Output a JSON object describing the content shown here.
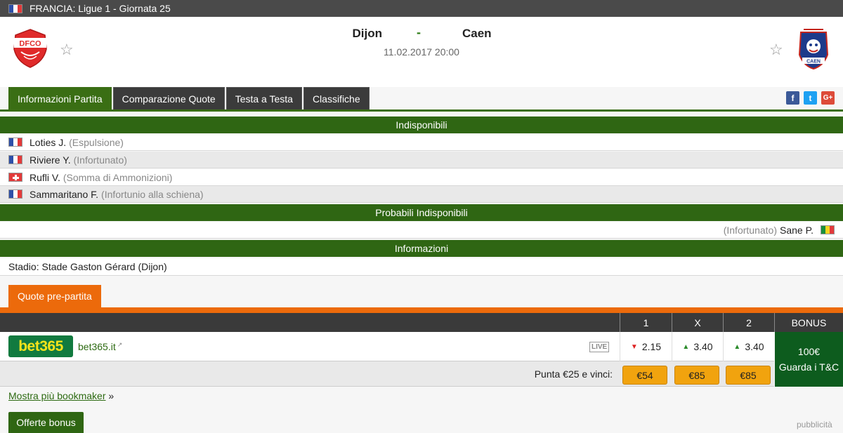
{
  "breadcrumb": {
    "country_league": "FRANCIA: Ligue 1 - Giornata 25"
  },
  "match": {
    "home_team": "Dijon",
    "away_team": "Caen",
    "separator": "-",
    "datetime": "11.02.2017 20:00",
    "home_logo_text": "DFCO",
    "away_logo_text": "CAEN"
  },
  "tabs": [
    {
      "label": "Informazioni Partita",
      "active": true
    },
    {
      "label": "Comparazione Quote",
      "active": false
    },
    {
      "label": "Testa a Testa",
      "active": false
    },
    {
      "label": "Classifiche",
      "active": false
    }
  ],
  "social": {
    "facebook": "f",
    "twitter": "t",
    "google": "G+"
  },
  "unavailable": {
    "title": "Indisponibili",
    "players": [
      {
        "name": "Loties J.",
        "reason": "(Espulsione)",
        "flag": "fr"
      },
      {
        "name": "Riviere Y.",
        "reason": "(Infortunato)",
        "flag": "fr"
      },
      {
        "name": "Rufli V.",
        "reason": "(Somma di Ammonizioni)",
        "flag": "ch"
      },
      {
        "name": "Sammaritano F.",
        "reason": "(Infortunio alla schiena)",
        "flag": "fr"
      }
    ]
  },
  "probable_unavailable": {
    "title": "Probabili Indisponibili",
    "players": [
      {
        "name": "Sane P.",
        "reason": "(Infortunato)",
        "flag": "sn"
      }
    ]
  },
  "info": {
    "title": "Informazioni",
    "stadium": "Stadio: Stade Gaston Gérard (Dijon)"
  },
  "odds": {
    "tab_label": "Quote pre-partita",
    "columns": {
      "home": "1",
      "draw": "X",
      "away": "2",
      "bonus": "BONUS"
    },
    "bookmaker": {
      "logo_text": "bet365",
      "link": "bet365.it",
      "live_badge": "LIVE",
      "home": {
        "value": "2.15",
        "trend": "down"
      },
      "draw": {
        "value": "3.40",
        "trend": "up"
      },
      "away": {
        "value": "3.40",
        "trend": "up"
      }
    },
    "stake_label": "Punta €25 e vinci:",
    "wins": {
      "home": "€54",
      "draw": "€85",
      "away": "€85"
    },
    "bonus": {
      "amount": "100€",
      "terms": "Guarda i T&C"
    }
  },
  "footer": {
    "more_bookmakers": "Mostra più bookmaker",
    "more_arrow": "»",
    "offers_button": "Offerte bonus",
    "ad_label": "pubblicità"
  },
  "colors": {
    "section_green": "#2f6613",
    "accent_orange": "#ec6a0b",
    "win_button": "#f1a30e",
    "bonus_green": "#0d5c1e"
  }
}
